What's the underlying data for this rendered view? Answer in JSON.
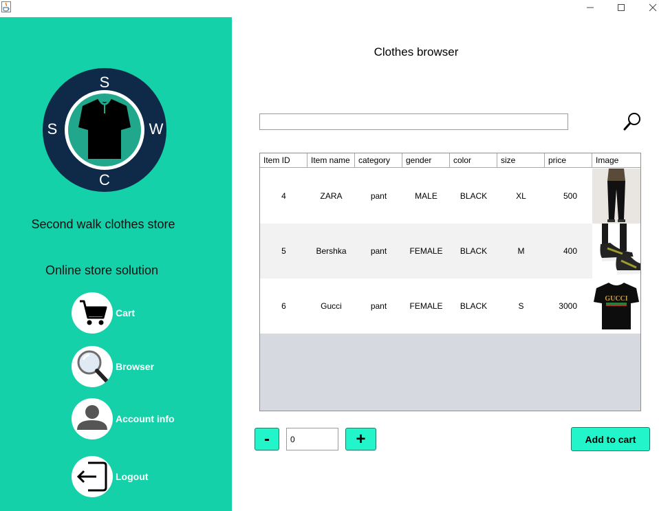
{
  "window": {
    "app_icon": "java-cup-icon",
    "minimize_icon": "minimize-icon",
    "maximize_icon": "maximize-icon",
    "close_icon": "close-icon"
  },
  "sidebar": {
    "background": "#14d1a9",
    "logo": {
      "letters": [
        "S",
        "W",
        "C",
        "S"
      ],
      "icon": "shirt-icon"
    },
    "store_name": "Second walk clothes store",
    "store_sub": "Online store solution",
    "nav": [
      {
        "label": "Cart",
        "icon": "cart-icon"
      },
      {
        "label": "Browser",
        "icon": "magnifier-icon"
      },
      {
        "label": "Account info",
        "icon": "user-icon"
      },
      {
        "label": "Logout",
        "icon": "logout-icon"
      }
    ]
  },
  "main": {
    "title": "Clothes browser",
    "search": {
      "value": "",
      "placeholder": "",
      "icon": "search-icon"
    },
    "table": {
      "headers": [
        "Item ID",
        "Item name",
        "category",
        "gender",
        "color",
        "size",
        "price",
        "Image"
      ],
      "rows": [
        {
          "id": "4",
          "name": "ZARA",
          "category": "pant",
          "gender": "MALE",
          "color": "BLACK",
          "size": "XL",
          "price": "500",
          "image": "black-pants-thumbnail"
        },
        {
          "id": "5",
          "name": "Bershka",
          "category": "pant",
          "gender": "FEMALE",
          "color": "BLACK",
          "size": "M",
          "price": "400",
          "image": "sneakers-thumbnail"
        },
        {
          "id": "6",
          "name": "Gucci",
          "category": "pant",
          "gender": "FEMALE",
          "color": "BLACK",
          "size": "S",
          "price": "3000",
          "image": "gucci-tshirt-thumbnail"
        }
      ],
      "image_text": "GUCCI"
    },
    "quantity": {
      "minus_label": "-",
      "plus_label": "+",
      "value": "0"
    },
    "add_to_cart_label": "Add to cart",
    "accent": "#22f5c9"
  }
}
